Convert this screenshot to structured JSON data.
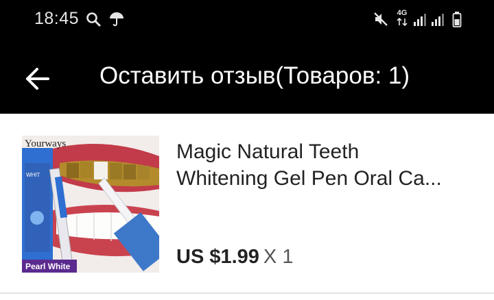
{
  "status_bar": {
    "time": "18:45",
    "network_label": "4G",
    "icons": [
      "search-icon",
      "umbrella-icon",
      "mute-icon",
      "signal-icon",
      "battery-icon"
    ]
  },
  "header": {
    "title": "Оставить отзыв(Товаров: 1)",
    "back_icon": "arrow-left-icon"
  },
  "product": {
    "image_brand": "Yourways",
    "image_label": "Pearl White",
    "name_line1": "Magic Natural Teeth",
    "name_line2": "Whitening Gel Pen Oral Ca...",
    "price": "US $1.99",
    "quantity": "X 1"
  },
  "colors": {
    "bar_background": "#000000",
    "page_background": "#ffffff",
    "text_primary": "#222222",
    "label_purple": "#5b2a8f"
  }
}
